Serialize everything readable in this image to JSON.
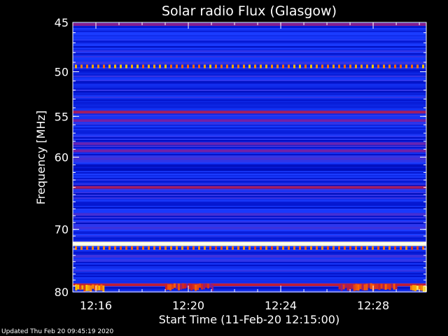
{
  "chart_data": {
    "type": "heatmap",
    "title": "Solar radio Flux (Glasgow)",
    "xlabel": "Start Time (11-Feb-20 12:15:00)",
    "ylabel": "Frequency [MHz]",
    "y_scale": "log",
    "ylim": [
      45,
      80
    ],
    "y_ticks": [
      45,
      50,
      55,
      60,
      70,
      80
    ],
    "y_tick_labels": [
      "45",
      "50",
      "55",
      "60",
      "70",
      "80"
    ],
    "x_range_minutes": [
      0,
      15.3
    ],
    "x_ticks_minutes": [
      1,
      5,
      9,
      13
    ],
    "x_tick_labels": [
      "12:16",
      "12:20",
      "12:24",
      "12:28"
    ],
    "colorscale": [
      "#000064",
      "#0010c8",
      "#1a3cff",
      "#7a1ea0",
      "#c81e28",
      "#ff6a00",
      "#ffd200",
      "#ffffd0"
    ],
    "bands": [
      {
        "freq_mhz": 45.2,
        "level": 0.45
      },
      {
        "freq_mhz": 49.4,
        "level": 0.7,
        "dashed": true
      },
      {
        "freq_mhz": 54.5,
        "level": 0.5
      },
      {
        "freq_mhz": 55.5,
        "level": 0.42
      },
      {
        "freq_mhz": 58.3,
        "level": 0.4
      },
      {
        "freq_mhz": 59.2,
        "level": 0.42
      },
      {
        "freq_mhz": 60.2,
        "level": 0.35
      },
      {
        "freq_mhz": 64.0,
        "level": 0.5
      },
      {
        "freq_mhz": 67.8,
        "level": 0.35
      },
      {
        "freq_mhz": 72.2,
        "level": 1.0
      },
      {
        "freq_mhz": 72.8,
        "level": 0.62,
        "dashed": true
      },
      {
        "freq_mhz": 78.8,
        "level": 0.55
      }
    ],
    "bursts": [
      {
        "t_start": 0.1,
        "t_end": 1.3,
        "freq_mhz": 79.2,
        "level": 0.75
      },
      {
        "t_start": 4.0,
        "t_end": 6.0,
        "freq_mhz": 79.0,
        "level": 0.6
      },
      {
        "t_start": 11.5,
        "t_end": 14.0,
        "freq_mhz": 79.0,
        "level": 0.62
      },
      {
        "t_start": 14.6,
        "t_end": 15.3,
        "freq_mhz": 79.3,
        "level": 0.85
      }
    ]
  },
  "footer": {
    "updated": "Updated Thu Feb 20 09:45:19 2020"
  }
}
